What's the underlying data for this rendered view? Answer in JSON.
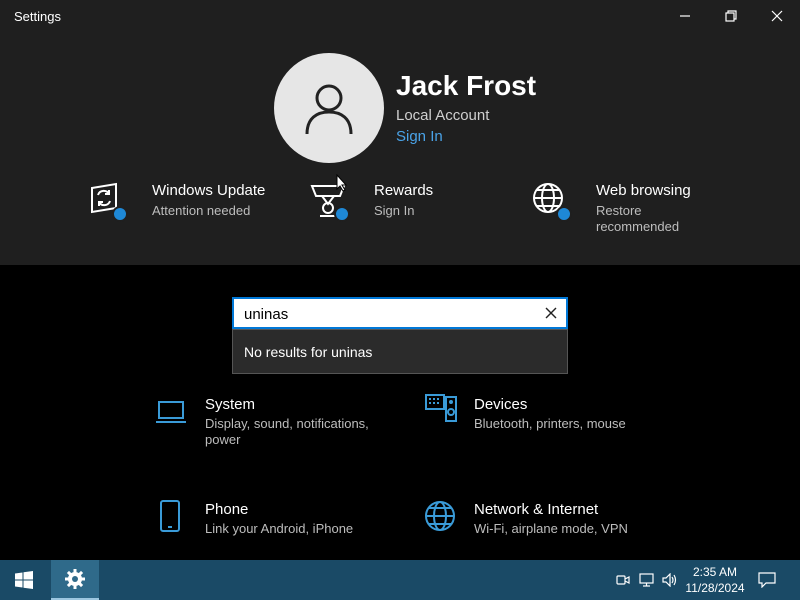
{
  "window": {
    "title": "Settings",
    "minimize_icon": "minimize-icon",
    "restore_icon": "restore-icon",
    "close_icon": "close-icon"
  },
  "profile": {
    "name": "Jack Frost",
    "account_type": "Local Account",
    "sign_in_link": "Sign In",
    "avatar_icon": "person-icon"
  },
  "status_items": [
    {
      "title": "Windows Update",
      "subtitle": "Attention needed",
      "icon": "windows-update-icon"
    },
    {
      "title": "Rewards",
      "subtitle": "Sign In",
      "icon": "rewards-trophy-icon"
    },
    {
      "title": "Web browsing",
      "subtitle": "Restore recommended",
      "icon": "globe-icon"
    }
  ],
  "search": {
    "value": "uninas",
    "no_results": "No results for uninas"
  },
  "categories": [
    {
      "title": "System",
      "subtitle": "Display, sound, notifications, power",
      "icon": "laptop-icon"
    },
    {
      "title": "Devices",
      "subtitle": "Bluetooth, printers, mouse",
      "icon": "keyboard-speaker-icon"
    },
    {
      "title": "Phone",
      "subtitle": "Link your Android, iPhone",
      "icon": "phone-icon"
    },
    {
      "title": "Network & Internet",
      "subtitle": "Wi-Fi, airplane mode, VPN",
      "icon": "globe-icon"
    }
  ],
  "taskbar": {
    "time": "2:35 AM",
    "date": "11/28/2024"
  },
  "colors": {
    "accent": "#0078d7",
    "link": "#4aa3e8",
    "status_dot": "#1e88d6",
    "icon_blue": "#3a9bd8",
    "taskbar": "#1a4a66"
  }
}
